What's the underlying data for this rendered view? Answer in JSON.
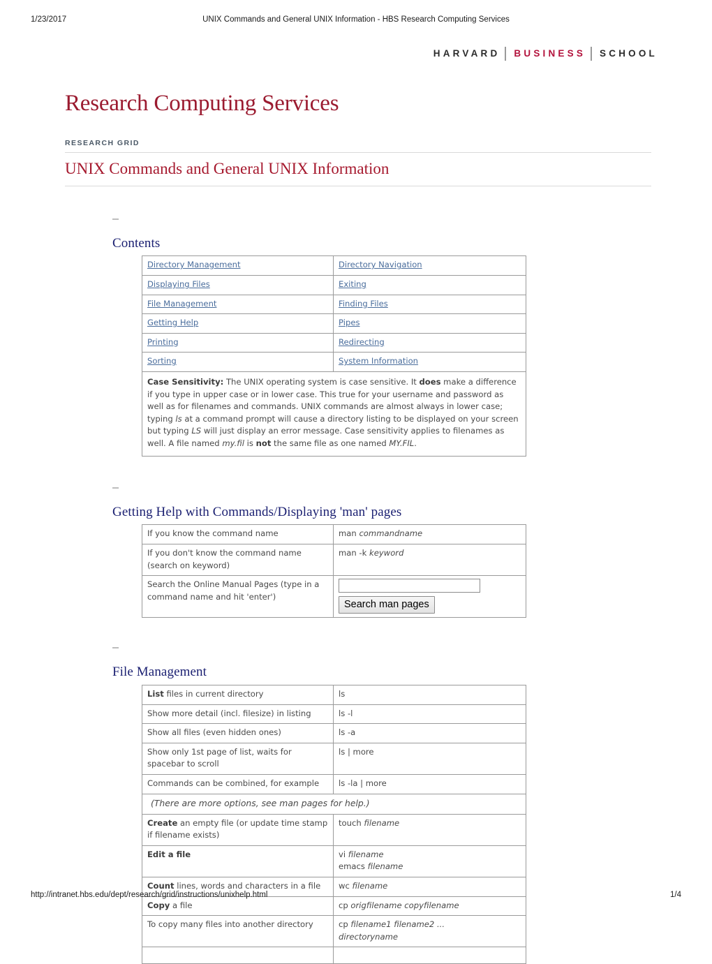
{
  "print": {
    "date": "1/23/2017",
    "header_title": "UNIX Commands and General UNIX Information - HBS Research Computing Services",
    "footer_url": "http://intranet.hbs.edu/dept/research/grid/instructions/unixhelp.html",
    "page_number": "1/4"
  },
  "logo": {
    "word1": "HARVARD",
    "word2": "BUSINESS",
    "word3": "SCHOOL"
  },
  "colors": {
    "crimson": "#9b1b30",
    "title_red": "#a6192e",
    "logo_red": "#b3123c",
    "heading_navy": "#1a1f71",
    "link_blue": "#4a6d9c",
    "kicker_slate": "#4a5866"
  },
  "site": {
    "title": "Research Computing Services",
    "kicker": "RESEARCH GRID",
    "page_title": "UNIX Commands and General UNIX Information"
  },
  "contents": {
    "heading": "Contents",
    "links": [
      [
        "Directory Management",
        "Directory Navigation"
      ],
      [
        "Displaying Files",
        "Exiting"
      ],
      [
        "File Management",
        "Finding Files"
      ],
      [
        "Getting Help",
        "Pipes"
      ],
      [
        "Printing",
        "Redirecting"
      ],
      [
        "Sorting",
        "System Information"
      ]
    ],
    "note": {
      "label": "Case Sensitivity:",
      "text_1": " The UNIX operating system is case sensitive. It ",
      "bold_1": "does",
      "text_2": " make a difference if you type in upper case or in lower case. This true for your username and password as well as for filenames and commands. UNIX commands are almost always in lower case; typing ",
      "ital_1": "ls",
      "text_3": " at a command prompt will cause a directory listing to be displayed on your screen but typing ",
      "ital_2": "LS",
      "text_4": " will just display an error message. Case sensitivity applies to filenames as well. A file named ",
      "ital_3": "my.fil",
      "text_5": " is ",
      "bold_2": "not",
      "text_6": " the same file as one named ",
      "ital_4": "MY.FIL",
      "text_7": "."
    }
  },
  "help": {
    "heading": "Getting Help with Commands/Displaying 'man' pages",
    "rows": [
      {
        "label": "If you know the command name",
        "cmd_plain": "man ",
        "cmd_ital": "commandname"
      },
      {
        "label": "If you don't know the command name (search on keyword)",
        "cmd_plain": "man -k ",
        "cmd_ital": "keyword"
      }
    ],
    "search_row": {
      "label": "Search the Online Manual Pages (type in a command name and hit 'enter')",
      "input_value": "",
      "input_placeholder": "",
      "button_label": "Search man pages"
    }
  },
  "file_management": {
    "heading": "File Management",
    "rows": [
      {
        "bold": "List",
        "plain": " files in current directory",
        "indent": false,
        "cmd": "ls",
        "cmd_ital": ""
      },
      {
        "bold": "",
        "plain": "Show more detail (incl. filesize) in listing",
        "indent": true,
        "cmd": "ls -l",
        "cmd_ital": ""
      },
      {
        "bold": "",
        "plain": "Show all files (even hidden ones)",
        "indent": true,
        "cmd": "ls -a",
        "cmd_ital": ""
      },
      {
        "bold": "",
        "plain": "Show only 1st page of list, waits for spacebar to scroll",
        "indent": true,
        "cmd": "ls | more",
        "cmd_ital": ""
      },
      {
        "bold": "",
        "plain": "Commands can be combined, for example",
        "indent": true,
        "cmd": "ls -la | more",
        "cmd_ital": ""
      }
    ],
    "full_row": "(There are more options, see man pages for help.)",
    "rows2": [
      {
        "bold": "Create",
        "plain": " an empty file (or update time stamp if filename exists)",
        "indent": false,
        "cmd": "touch ",
        "cmd_ital": "filename",
        "cmd_line2": "",
        "cmd_line2_ital": ""
      },
      {
        "bold": "Edit a file",
        "plain": "",
        "indent": false,
        "cmd": "vi ",
        "cmd_ital": "filename",
        "cmd_line2": "emacs ",
        "cmd_line2_ital": "filename"
      },
      {
        "bold": "Count",
        "plain": " lines, words and characters in a file",
        "indent": false,
        "cmd": "wc ",
        "cmd_ital": "filename",
        "cmd_line2": "",
        "cmd_line2_ital": ""
      },
      {
        "bold": "Copy",
        "plain": " a file",
        "indent": false,
        "cmd": "cp ",
        "cmd_ital": "origfilename copyfilename",
        "cmd_line2": "",
        "cmd_line2_ital": ""
      },
      {
        "bold": "",
        "plain": "To copy many files into another directory",
        "indent": true,
        "cmd": "cp ",
        "cmd_ital": "filename1 filename2 ...",
        "cmd_line2": "",
        "cmd_line2_ital": "directoryname"
      }
    ]
  }
}
